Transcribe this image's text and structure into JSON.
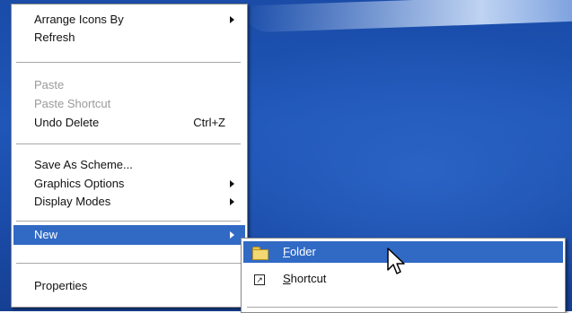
{
  "context_menu": {
    "items": [
      {
        "label": "Arrange Icons By",
        "submenu": true
      },
      {
        "label": "Refresh"
      },
      {
        "label": "Paste",
        "disabled": true
      },
      {
        "label": "Paste Shortcut",
        "disabled": true
      },
      {
        "label": "Undo Delete",
        "accelerator": "Ctrl+Z"
      },
      {
        "label": "Save As Scheme..."
      },
      {
        "label": "Graphics Options",
        "submenu": true
      },
      {
        "label": "Display Modes",
        "submenu": true
      },
      {
        "label": "New",
        "submenu": true,
        "selected": true
      },
      {
        "label": "Properties"
      }
    ]
  },
  "new_submenu": {
    "folder": {
      "mnemonic": "F",
      "rest": "older",
      "selected": true
    },
    "shortcut": {
      "mnemonic": "S",
      "rest": "hortcut"
    }
  },
  "colors": {
    "selection": "#316ac5",
    "desktop": "#1f56b8",
    "disabled_text": "#9a9a9a"
  },
  "icons": [
    "chevron-right-icon",
    "folder-icon",
    "shortcut-icon",
    "mouse-cursor-icon"
  ]
}
